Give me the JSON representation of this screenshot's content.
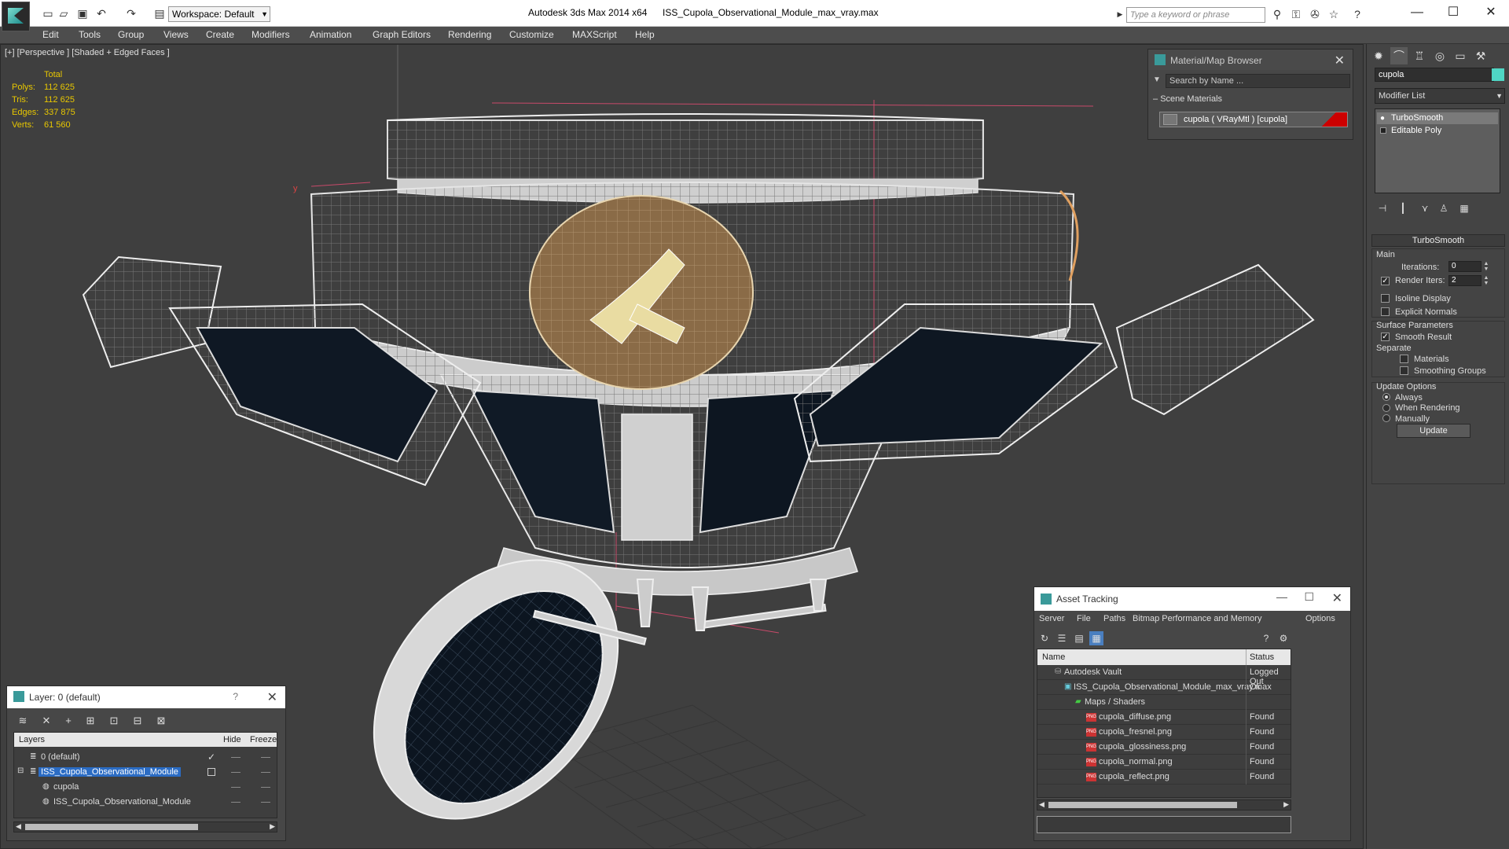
{
  "titlebar": {
    "workspace": "Workspace: Default",
    "app_title": "Autodesk 3ds Max  2014 x64",
    "file_title": "ISS_Cupola_Observational_Module_max_vray.max",
    "search_placeholder": "Type a keyword or phrase"
  },
  "menu": [
    "Edit",
    "Tools",
    "Group",
    "Views",
    "Create",
    "Modifiers",
    "Animation",
    "Graph Editors",
    "Rendering",
    "Customize",
    "MAXScript",
    "Help"
  ],
  "viewport": {
    "label": "[+] [Perspective ] [Shaded + Edged Faces ]",
    "stats": {
      "header": "Total",
      "rows": [
        {
          "label": "Polys:",
          "value": "112 625"
        },
        {
          "label": "Tris:",
          "value": "112 625"
        },
        {
          "label": "Edges:",
          "value": "337 875"
        },
        {
          "label": "Verts:",
          "value": "61 560"
        }
      ]
    },
    "axis_label": "y"
  },
  "material_browser": {
    "title": "Material/Map Browser",
    "search_placeholder": "Search by Name ...",
    "group": "Scene Materials",
    "item": "cupola  ( VRayMtl )  [cupola]"
  },
  "command_panel": {
    "object_name": "cupola",
    "object_color": "#4fd6c4",
    "modifier_list": "Modifier List",
    "stack": [
      "TurboSmooth",
      "Editable Poly"
    ],
    "rollout_title": "TurboSmooth",
    "main_label": "Main",
    "iterations_label": "Iterations:",
    "iterations_value": "0",
    "render_iters_label": "Render Iters:",
    "render_iters_value": "2",
    "isoline_label": "Isoline Display",
    "explicit_normals_label": "Explicit Normals",
    "surface_params_label": "Surface Parameters",
    "smooth_result_label": "Smooth Result",
    "separate_label": "Separate",
    "materials_label": "Materials",
    "smoothing_groups_label": "Smoothing Groups",
    "update_options_label": "Update Options",
    "always_label": "Always",
    "when_rendering_label": "When Rendering",
    "manually_label": "Manually",
    "update_button": "Update"
  },
  "asset_tracking": {
    "title": "Asset Tracking",
    "menu": [
      "Server",
      "File",
      "Paths",
      "Bitmap Performance and Memory",
      "Options"
    ],
    "columns": [
      "Name",
      "Status"
    ],
    "rows": [
      {
        "name": "Autodesk Vault",
        "status": "Logged Out"
      },
      {
        "name": "ISS_Cupola_Observational_Module_max_vray.max",
        "status": "Ok"
      },
      {
        "name": "Maps / Shaders",
        "status": ""
      },
      {
        "name": "cupola_diffuse.png",
        "status": "Found"
      },
      {
        "name": "cupola_fresnel.png",
        "status": "Found"
      },
      {
        "name": "cupola_glossiness.png",
        "status": "Found"
      },
      {
        "name": "cupola_normal.png",
        "status": "Found"
      },
      {
        "name": "cupola_reflect.png",
        "status": "Found"
      }
    ]
  },
  "layers": {
    "title": "Layer: 0 (default)",
    "help": "?",
    "columns": [
      "Layers",
      "Hide",
      "Freeze"
    ],
    "rows": [
      {
        "name": "0 (default)"
      },
      {
        "name": "ISS_Cupola_Observational_Module"
      },
      {
        "name": "cupola"
      },
      {
        "name": "ISS_Cupola_Observational_Module"
      }
    ]
  }
}
